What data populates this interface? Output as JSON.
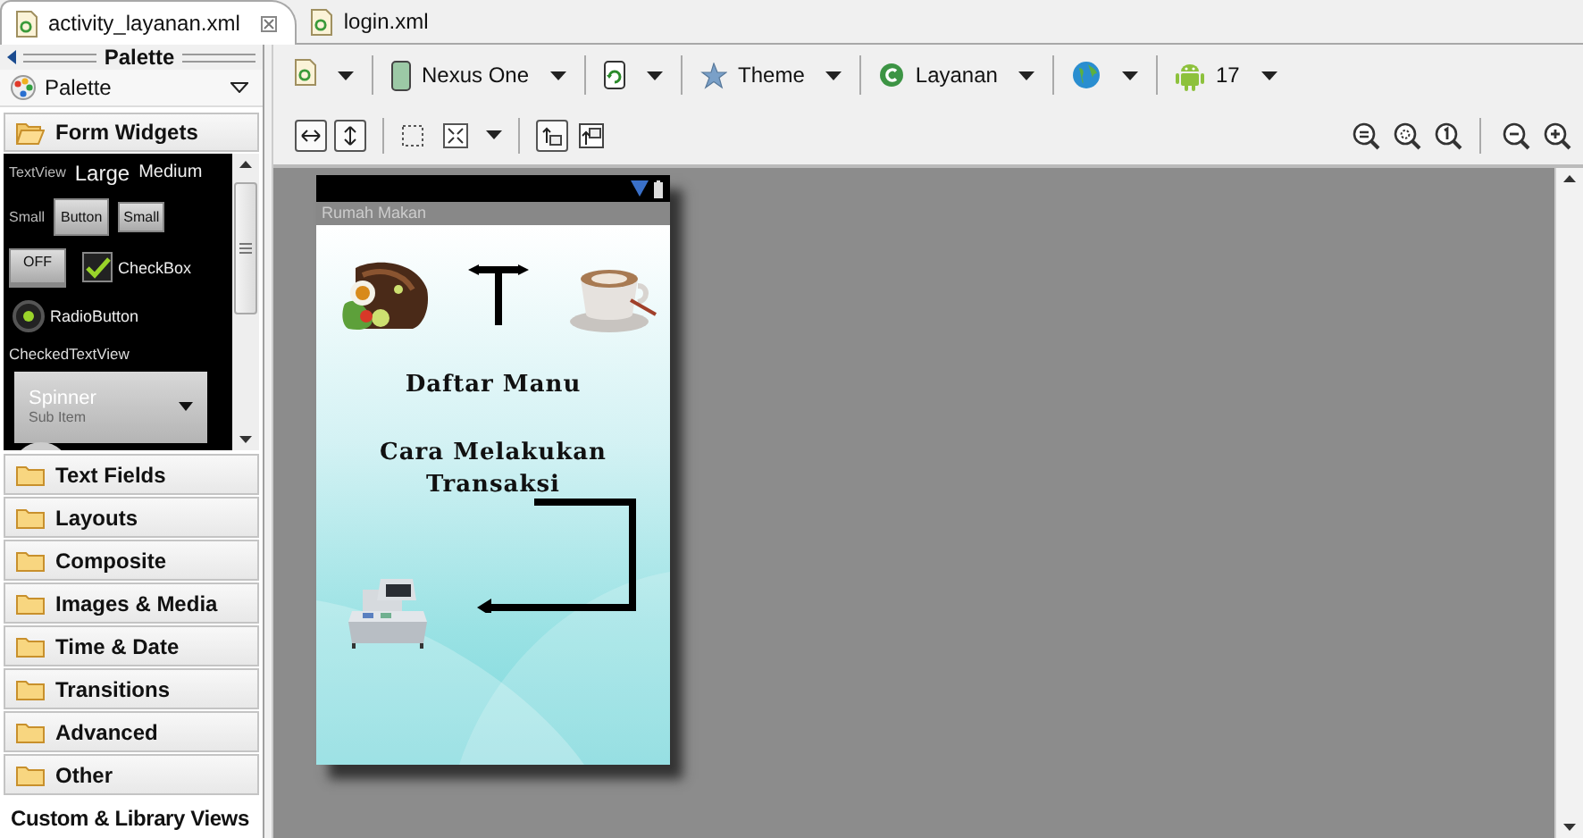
{
  "tabs": [
    {
      "label": "activity_layanan.xml",
      "selected": true
    },
    {
      "label": "login.xml",
      "selected": false
    }
  ],
  "palette": {
    "title": "Palette",
    "selector": "Palette",
    "open_category": {
      "label": "Form Widgets",
      "expanded": true
    },
    "preview_rows": [
      [
        {
          "kind": "tinytext",
          "label": "TextView"
        },
        {
          "kind": "largetext",
          "label": "Large"
        },
        {
          "kind": "mediumtext",
          "label": "Medium"
        }
      ],
      [
        {
          "kind": "tinytext",
          "label": "Small"
        },
        {
          "kind": "button",
          "label": "Button"
        },
        {
          "kind": "smallbutton",
          "label": "Small"
        }
      ],
      [
        {
          "kind": "toggle",
          "label": "OFF"
        },
        {
          "kind": "checkbox",
          "label": "CheckBox",
          "checked": true
        }
      ],
      [
        {
          "kind": "radio",
          "label": "RadioButton",
          "selected": true
        }
      ],
      [
        {
          "kind": "smalltext",
          "label": "CheckedTextView"
        }
      ],
      [
        {
          "kind": "spinner",
          "label": "Spinner",
          "sub": "Sub Item"
        }
      ]
    ],
    "categories": [
      {
        "label": "Text Fields",
        "kind": "folder"
      },
      {
        "label": "Layouts",
        "kind": "folder"
      },
      {
        "label": "Composite",
        "kind": "folder"
      },
      {
        "label": "Images & Media",
        "kind": "folder"
      },
      {
        "label": "Time & Date",
        "kind": "folder"
      },
      {
        "label": "Transitions",
        "kind": "folder"
      },
      {
        "label": "Advanced",
        "kind": "folder"
      },
      {
        "label": "Other",
        "kind": "folder"
      },
      {
        "label": "Custom & Library Views",
        "kind": "plain"
      }
    ]
  },
  "toolbar": [
    {
      "kind": "doc"
    },
    {
      "kind": "device",
      "label": "Nexus One"
    },
    {
      "kind": "rotate"
    },
    {
      "kind": "theme",
      "label": "Theme"
    },
    {
      "kind": "activity",
      "label": "Layanan"
    },
    {
      "kind": "locale"
    },
    {
      "kind": "api",
      "label": "17"
    }
  ],
  "phone": {
    "app_title": "Rumah Makan",
    "menu": [
      "Daftar Manu",
      "Cara Melakukan Transaksi"
    ]
  }
}
